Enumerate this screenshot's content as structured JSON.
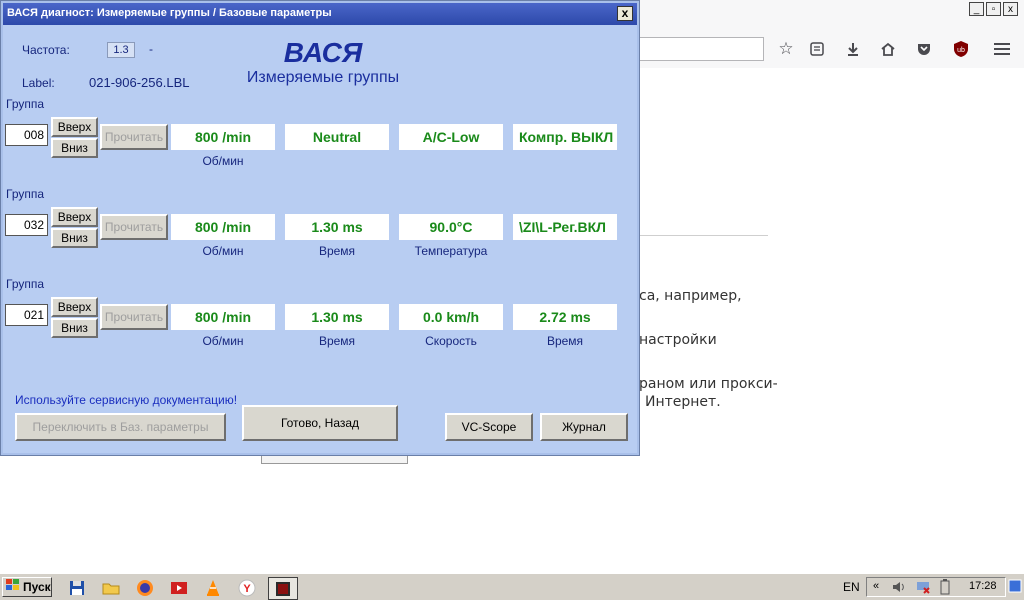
{
  "browser": {
    "bg_lines": [
      "са, например,",
      "настройки",
      "раном или прокси-",
      "Интернет."
    ]
  },
  "window": {
    "title": "ВАСЯ диагност: Измеряемые группы / Базовые параметры",
    "close": "x"
  },
  "header": {
    "freq_label": "Частота:",
    "freq_value": "1.3",
    "freq_dash": "-",
    "label_label": "Label:",
    "label_value": "021-906-256.LBL",
    "app_name": "ВАСЯ",
    "subtitle": "Измеряемые группы"
  },
  "groups": [
    {
      "label": "Группа",
      "number": "008",
      "up": "Вверх",
      "down": "Вниз",
      "read": "Прочитать",
      "values": [
        "800 /min",
        "Neutral",
        "A/C-Low",
        "Компр. ВЫКЛ"
      ],
      "units": [
        "Об/мин",
        "",
        "",
        ""
      ]
    },
    {
      "label": "Группа",
      "number": "032",
      "up": "Вверх",
      "down": "Вниз",
      "read": "Прочитать",
      "values": [
        "800 /min",
        "1.30 ms",
        "90.0°C",
        "\\ZI\\L-Рег.ВКЛ"
      ],
      "units": [
        "Об/мин",
        "Время",
        "Температура",
        ""
      ]
    },
    {
      "label": "Группа",
      "number": "021",
      "up": "Вверх",
      "down": "Вниз",
      "read": "Прочитать",
      "values": [
        "800 /min",
        "1.30 ms",
        "0.0 km/h",
        "2.72 ms"
      ],
      "units": [
        "Об/мин",
        "Время",
        "Скорость",
        "Время"
      ]
    }
  ],
  "footer": {
    "note": "Используйте сервисную документацию!",
    "switch_btn": "Переключить в Баз. параметры",
    "done_btn": "Готово, Назад",
    "vcscope_btn": "VC-Scope",
    "log_btn": "Журнал"
  },
  "taskbar": {
    "start": "Пуск",
    "lang": "EN",
    "time": "17:28"
  }
}
